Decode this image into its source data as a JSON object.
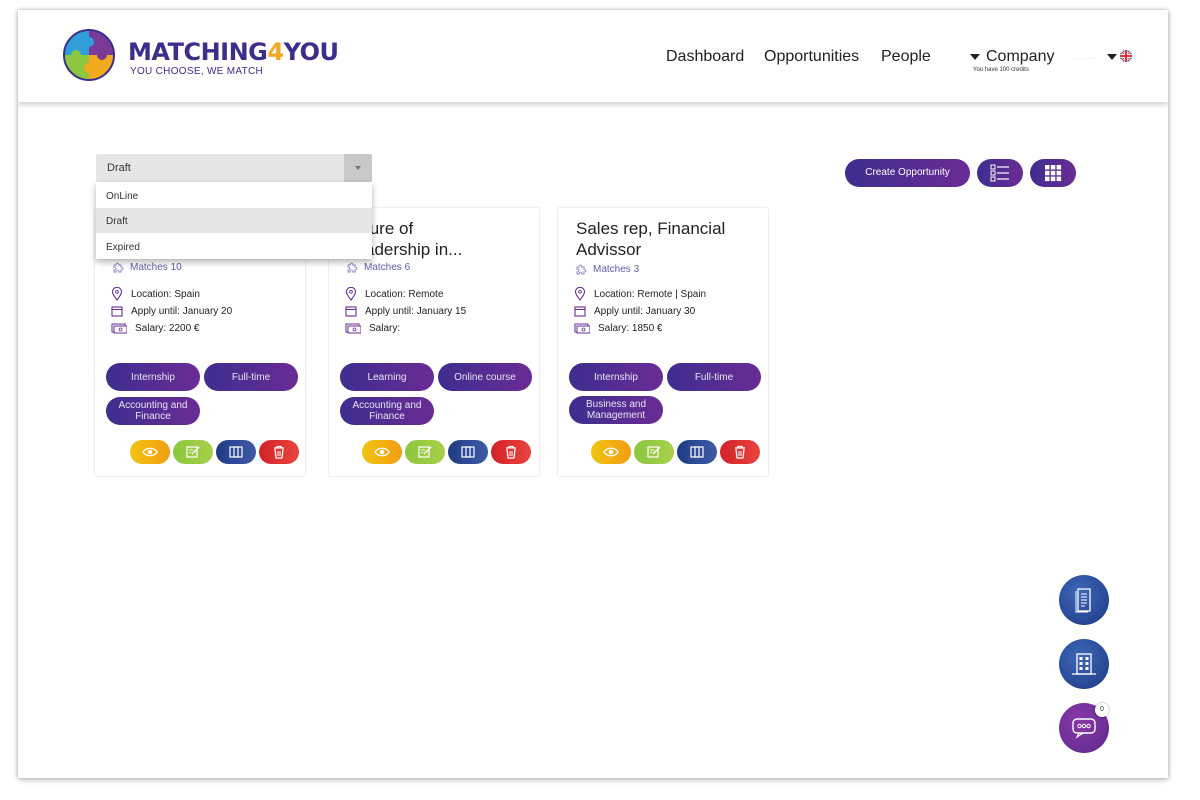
{
  "brand": {
    "name_part1": "MATCHING",
    "name_part2": "4",
    "name_part3": "YOU",
    "tagline": "YOU CHOOSE, WE MATCH"
  },
  "nav": {
    "dashboard": "Dashboard",
    "opportunities": "Opportunities",
    "people": "People",
    "company": "Company",
    "credits": "You have 100 credits"
  },
  "filter": {
    "selected": "Draft",
    "options": [
      "OnLine",
      "Draft",
      "Expired"
    ]
  },
  "toolbar": {
    "create_label": "Create Opportunity"
  },
  "cards": [
    {
      "title": "",
      "matches": "Matches 10",
      "location": "Location: Spain",
      "apply_until": "Apply until: January 20",
      "salary": "Salary: 2200 €",
      "tags": [
        "Internship",
        "Full-time",
        "Accounting and Finance"
      ]
    },
    {
      "title": "...ture of ...adership in...",
      "title_line1": "ture of",
      "title_line2": "adership in...",
      "matches": "Matches 6",
      "location": "Location: Remote",
      "apply_until": "Apply until: January 15",
      "salary": "Salary:",
      "tags": [
        "Learning",
        "Online course",
        "Accounting and Finance"
      ]
    },
    {
      "title": "Sales rep, Financial Advissor",
      "matches": "Matches 3",
      "location": "Location: Remote | Spain",
      "apply_until": "Apply until: January 30",
      "salary": "Salary: 1850 €",
      "tags": [
        "Internship",
        "Full-time",
        "Business and Management"
      ]
    }
  ],
  "chat": {
    "unread": "0"
  },
  "colors": {
    "brand_purple": "#3d2e8f",
    "accent_orange": "#f2a91d",
    "view_yellow": "#f1c40f",
    "edit_green": "#8dc63f",
    "duplicate_blue": "#1f3b85",
    "delete_red": "#d4202a"
  }
}
